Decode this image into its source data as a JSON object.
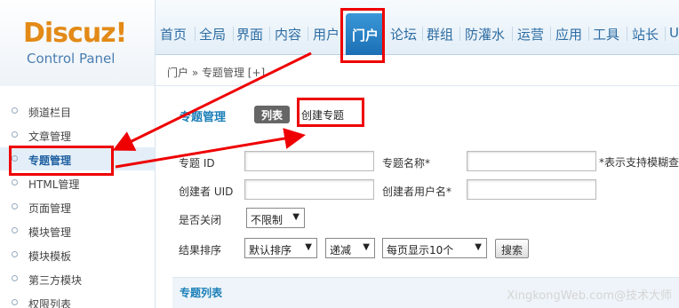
{
  "logo": {
    "main": "Discuz!",
    "sub": "Control Panel"
  },
  "topnav": [
    "首页",
    "全局",
    "界面",
    "内容",
    "用户",
    "门户",
    "论坛",
    "群组",
    "防灌水",
    "运营",
    "应用",
    "工具",
    "站长",
    "U"
  ],
  "breadcrumb": "门户 » 专题管理  [+]",
  "sidebar": [
    "频道栏目",
    "文章管理",
    "专题管理",
    "HTML管理",
    "页面管理",
    "模块管理",
    "模块模板",
    "第三方模块",
    "权限列表"
  ],
  "main": {
    "title": "专题管理",
    "tab_list": "列表",
    "tab_create": "创建专题"
  },
  "form": {
    "topic_id_label": "专题 ID",
    "topic_name_label": "专题名称*",
    "fuzzy_hint": "*表示支持模糊查",
    "creator_uid_label": "创建者 UID",
    "creator_name_label": "创建者用户名*",
    "closed_label": "是否关闭",
    "closed_value": "不限制",
    "sort_label": "结果排序",
    "sort_value": "默认排序",
    "order_value": "递减",
    "perpage_value": "每页显示10个",
    "search_button": "搜索"
  },
  "list_title": "专题列表",
  "watermark": "XingkongWeb.com@技术大师",
  "colors": {
    "annotation": "#e00000",
    "accent": "#1b7fb8"
  }
}
